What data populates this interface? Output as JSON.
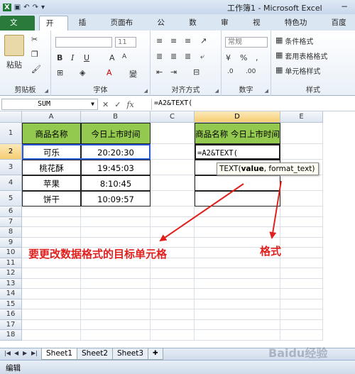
{
  "window": {
    "title": "工作簿1 - Microsoft Excel"
  },
  "ribbon_tabs": [
    "文件",
    "开始",
    "插入",
    "页面布局",
    "公式",
    "数据",
    "审阅",
    "视图",
    "特色功能",
    "百度网"
  ],
  "ribbon": {
    "paste_label": "粘贴",
    "font_size": "11",
    "number_format": "常规",
    "groups": {
      "clipboard": "剪贴板",
      "font": "字体",
      "alignment": "对齐方式",
      "number": "数字",
      "styles": "样式"
    },
    "styles_items": [
      "条件格式",
      "套用表格格式",
      "单元格样式"
    ]
  },
  "formula_bar": {
    "name_box": "SUM",
    "formula": "=A2&TEXT("
  },
  "columns": [
    "A",
    "B",
    "C",
    "D",
    "E"
  ],
  "rows": [
    "1",
    "2",
    "3",
    "4",
    "5",
    "6",
    "7",
    "8",
    "9",
    "10",
    "11",
    "12",
    "13",
    "14",
    "15",
    "16",
    "17",
    "18"
  ],
  "cells": {
    "A1": "商品名称",
    "B1": "今日上市时间",
    "A2": "可乐",
    "B2": "20:20:30",
    "A3": "桃花酥",
    "B3": "19:45:03",
    "A4": "苹果",
    "B4": "8:10:45",
    "A5": "饼干",
    "B5": "10:09:57",
    "D1": "商品名称 今日上市时间",
    "D2": "=A2&TEXT("
  },
  "tooltip": {
    "func": "TEXT(",
    "arg1": "value",
    ", ": ", ",
    "arg2": "format_text",
    ")": ")"
  },
  "annotations": {
    "left": "要更改数据格式的目标单元格",
    "right": "格式"
  },
  "sheets": [
    "Sheet1",
    "Sheet2",
    "Sheet3"
  ],
  "status": "编辑",
  "watermark": "Baidu经验",
  "colors": {
    "header_fill": "#93c94f",
    "annotation": "#e0201e",
    "file_tab": "#2a7b3b"
  }
}
